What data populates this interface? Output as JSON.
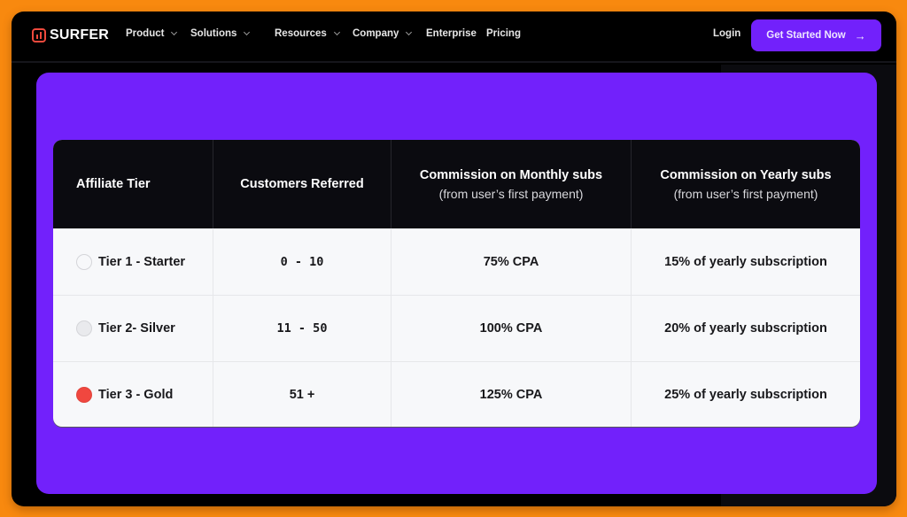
{
  "nav": {
    "logo_text": "SURFER",
    "items": [
      {
        "label": "Product",
        "has_dropdown": true
      },
      {
        "label": "Solutions",
        "has_dropdown": true
      },
      {
        "label": "Resources",
        "has_dropdown": true
      },
      {
        "label": "Company",
        "has_dropdown": true
      },
      {
        "label": "Enterprise",
        "has_dropdown": false
      },
      {
        "label": "Pricing",
        "has_dropdown": false
      }
    ],
    "login_label": "Login",
    "cta_label": "Get Started Now",
    "cta_icon": "arrow-right-icon"
  },
  "colors": {
    "background": "#f8890f",
    "accent": "#7221fb",
    "logo": "#ef4a3d",
    "table_header": "#0b0b10"
  },
  "table": {
    "headers": [
      {
        "title": "Affiliate Tier",
        "subtitle": ""
      },
      {
        "title": "Customers Referred",
        "subtitle": ""
      },
      {
        "title": "Commission on Monthly subs",
        "subtitle": "(from user’s first payment)"
      },
      {
        "title": "Commission on Yearly subs",
        "subtitle": "(from user’s first payment)"
      }
    ],
    "rows": [
      {
        "tier": "Tier 1 - Starter",
        "tier_color": "#f7f8fa",
        "customers": "0 - 10",
        "monthly": "75% CPA",
        "yearly": "15% of yearly subscription"
      },
      {
        "tier": "Tier 2- Silver",
        "tier_color": "#e9eaed",
        "customers": "11 - 50",
        "monthly": "100% CPA",
        "yearly": "20% of yearly subscription"
      },
      {
        "tier": "Tier 3 - Gold",
        "tier_color": "#f0473f",
        "customers": "51 +",
        "monthly": "125% CPA",
        "yearly": "25% of yearly subscription"
      }
    ]
  }
}
